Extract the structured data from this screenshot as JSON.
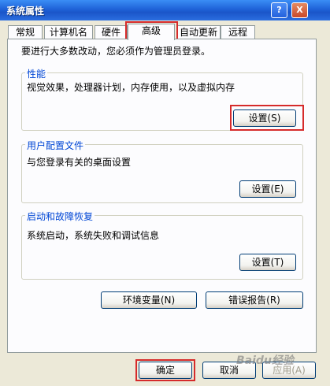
{
  "window": {
    "title": "系统属性",
    "help_glyph": "?",
    "close_glyph": "X"
  },
  "tabs": [
    {
      "label": "常规"
    },
    {
      "label": "计算机名"
    },
    {
      "label": "硬件"
    },
    {
      "label": "高级"
    },
    {
      "label": "自动更新"
    },
    {
      "label": "远程"
    }
  ],
  "active_tab": "高级",
  "intro": "要进行大多数改动，您必须作为管理员登录。",
  "performance": {
    "legend": "性能",
    "description": "视觉效果，处理器计划，内存使用，以及虚拟内存",
    "button": "设置(S)"
  },
  "user_profiles": {
    "legend": "用户配置文件",
    "description": "与您登录有关的桌面设置",
    "button": "设置(E)"
  },
  "startup_recovery": {
    "legend": "启动和故障恢复",
    "description": "系统启动，系统失败和调试信息",
    "button": "设置(T)"
  },
  "env_button": "环境变量(N)",
  "error_button": "错误报告(R)",
  "footer": {
    "ok": "确定",
    "cancel": "取消",
    "apply": "应用(A)"
  },
  "watermark": "Baidu经验",
  "colors": {
    "titlebar": "#1f62d8",
    "highlight": "#d62b2b",
    "legend": "#0046d5",
    "panel": "#fcfcfe",
    "window": "#ece9d8"
  }
}
